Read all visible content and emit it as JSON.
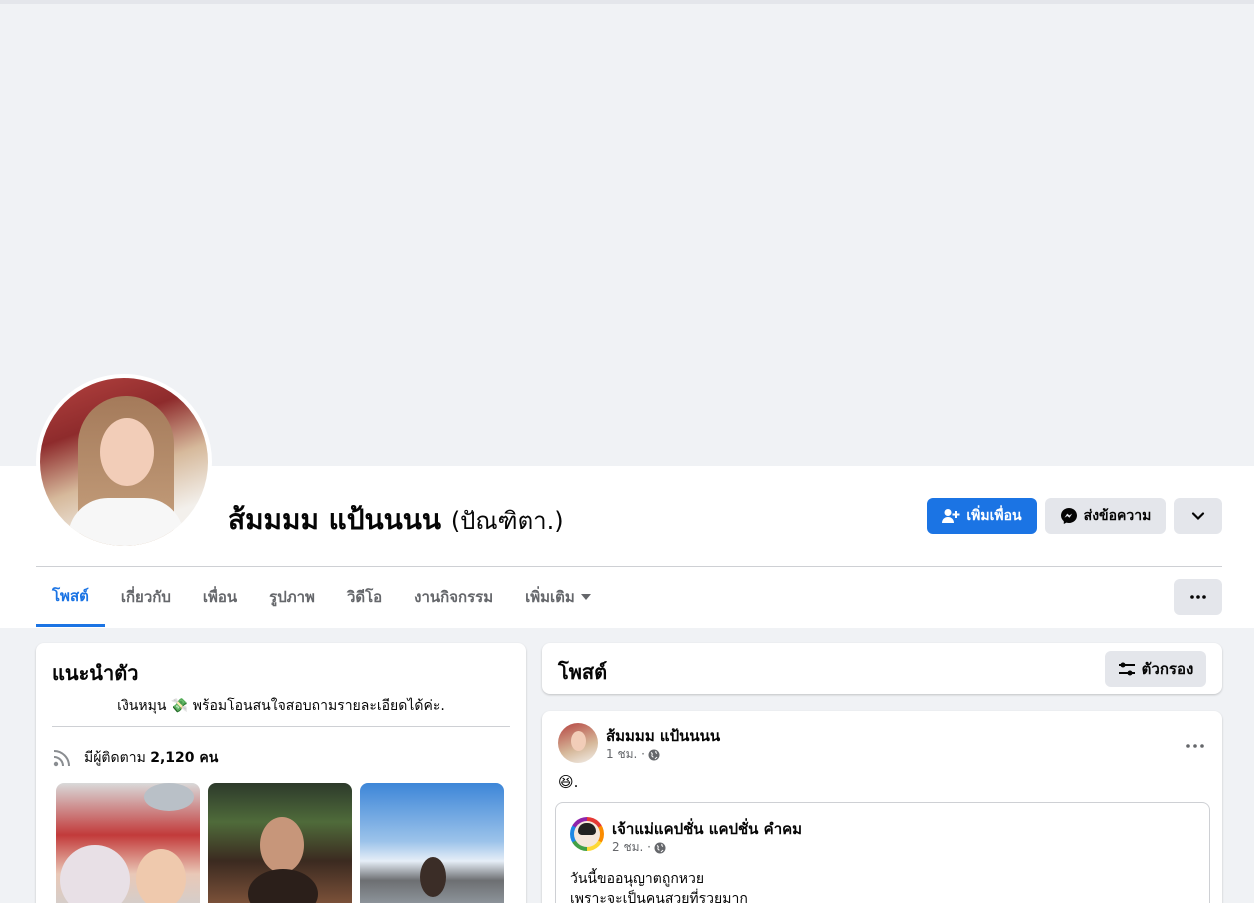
{
  "profile": {
    "name": "ส้มมมม แป้นนนน",
    "alt_name": "(ปัณฑิตา.)"
  },
  "actions": {
    "add_friend": "เพิ่มเพื่อน",
    "message": "ส่งข้อความ"
  },
  "tabs": [
    {
      "label": "โพสต์",
      "active": true
    },
    {
      "label": "เกี่ยวกับ"
    },
    {
      "label": "เพื่อน"
    },
    {
      "label": "รูปภาพ"
    },
    {
      "label": "วิดีโอ"
    },
    {
      "label": "งานกิจกรรม"
    },
    {
      "label": "เพิ่มเติม"
    }
  ],
  "intro": {
    "title": "แนะนำตัว",
    "bio_before": "เงินหมุน",
    "bio_emoji": "💸",
    "bio_after": "พร้อมโอนสนใจสอบถามรายละเอียดได้ค่ะ.",
    "followers_prefix": "มีผู้ติดตาม",
    "followers_count": "2,120 คน"
  },
  "posts_section": {
    "title": "โพสต์",
    "filter_label": "ตัวกรอง"
  },
  "post": {
    "author": "ส้มมมม แป้นนนน",
    "time": "1 ชม. ·",
    "text": "😆.",
    "shared": {
      "author": "เจ้าแม่แคปชั่น แคปชั่น คำคม",
      "time": "2 ชม. ·",
      "line1": "วันนี้ขออนุญาตถูกหวย",
      "line2": "เพราะจะเป็นคนสวยที่รวยมาก"
    }
  },
  "colors": {
    "accent": "#1b74e4",
    "background": "#f0f2f5",
    "button_gray": "#e4e6eb",
    "secondary_text": "#65676b"
  },
  "icons": {
    "add_friend": "user-plus-icon",
    "message": "messenger-icon",
    "more": "chevron-down-icon",
    "dots": "ellipsis-icon",
    "followers": "rss-icon",
    "filter": "sliders-icon",
    "privacy": "globe-icon"
  }
}
